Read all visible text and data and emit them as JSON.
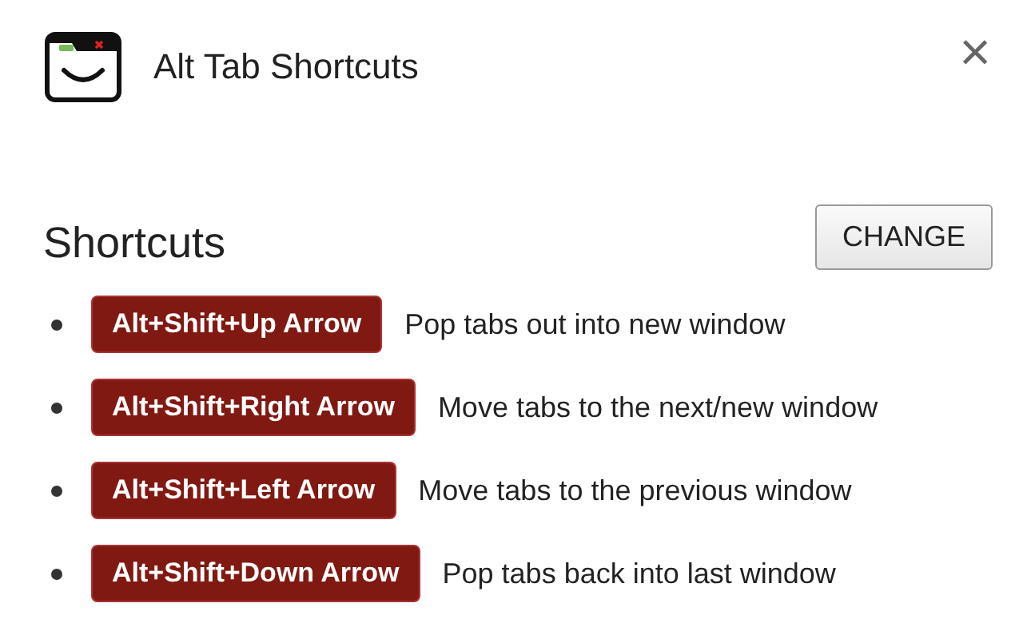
{
  "header": {
    "title": "Alt Tab Shortcuts",
    "close": "×"
  },
  "section": {
    "heading": "Shortcuts",
    "button": "CHANGE"
  },
  "shortcuts": [
    {
      "keys": "Alt+Shift+Up Arrow",
      "description": "Pop tabs out into new window"
    },
    {
      "keys": "Alt+Shift+Right Arrow",
      "description": "Move tabs to the next/new window"
    },
    {
      "keys": "Alt+Shift+Left Arrow",
      "description": "Move tabs to the previous window"
    },
    {
      "keys": "Alt+Shift+Down Arrow",
      "description": "Pop tabs back into last window"
    }
  ]
}
